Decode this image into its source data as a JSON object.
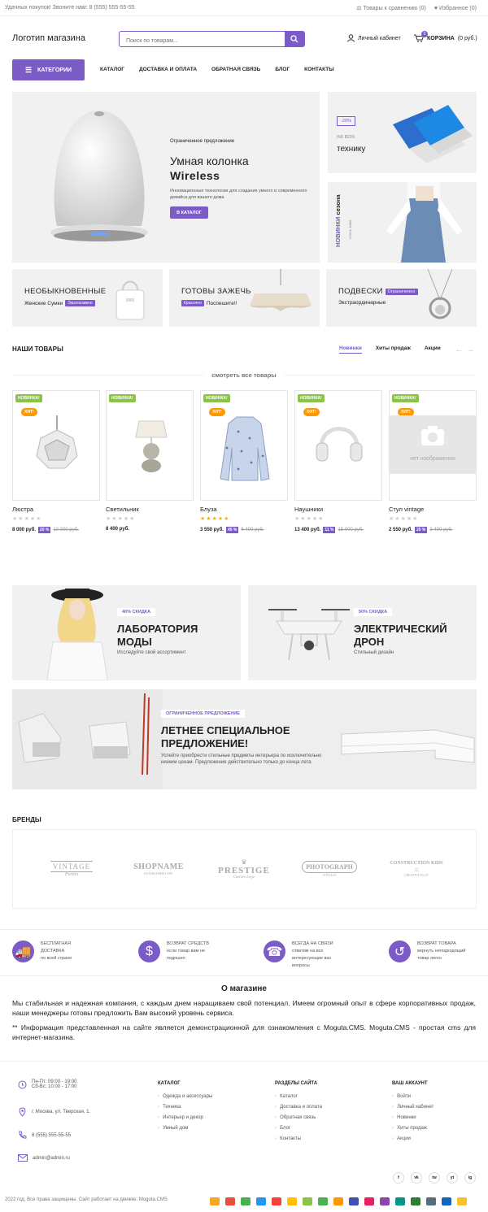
{
  "topbar": {
    "left_text": "Удачных покупок! Звоните нам: 8 (555) 555-55-55",
    "compare": "Товары к сравнению (0)",
    "favorites": "Избранное (0)"
  },
  "header": {
    "logo": "Логотип магазина",
    "search_placeholder": "Поиск по товарам...",
    "account": "Личный кабинет",
    "cart_label": "КОРЗИНА",
    "cart_total": "(0 руб.)",
    "cart_count": "0"
  },
  "nav": {
    "categories": "КАТЕГОРИИ",
    "links": [
      "КАТАЛОГ",
      "ДОСТАВКА И ОПЛАТА",
      "ОБРАТНАЯ СВЯЗЬ",
      "БЛОГ",
      "КОНТАКТЫ"
    ]
  },
  "hero": {
    "eyebrow": "Ограниченное предложение",
    "title_line1": "Умная колонка",
    "title_line2": "Wireless",
    "text": "Инновационные технологии для создания умного и современного девайса для вашего дома",
    "cta": "В КАТАЛОГ"
  },
  "side_banner1": {
    "badge": "-20%",
    "line1": "на всю",
    "line2": "технику"
  },
  "side_banner2": {
    "line1": "НОВИНКИ",
    "line2": "сезона",
    "line3": "осень зима"
  },
  "small_banners": [
    {
      "title": "НЕОБЫКНОВЕННЫЕ",
      "sub": "Женские Сумки",
      "tag": "Эксклюзивно"
    },
    {
      "title": "ГОТОВЫ ЗАЖЕЧЬ",
      "tag": "Красочно",
      "sub": "Поспешите!!"
    },
    {
      "title": "ПОДВЕСКИ",
      "tag": "Ограниченно",
      "sub": "Экстраординарные"
    }
  ],
  "products_section": {
    "title": "НАШИ ТОВАРЫ",
    "tabs": [
      "Новинки",
      "Хиты продаж",
      "Акции"
    ],
    "see_all": "смотреть все товары",
    "new_badge": "НОВИНКА!",
    "hit_badge": "ХИТ!",
    "no_image": "нет изображения"
  },
  "products": [
    {
      "name": "Люстра",
      "price": "8 000 руб.",
      "discount": "20 %",
      "old_price": "10 000 руб.",
      "rating": 0,
      "hit": true
    },
    {
      "name": "Светильник",
      "price": "8 400 руб.",
      "discount": "",
      "old_price": "",
      "rating": 0,
      "hit": false
    },
    {
      "name": "Блуза",
      "price": "3 550 руб.",
      "discount": "45 %",
      "old_price": "6 400 руб.",
      "rating": 5,
      "hit": true
    },
    {
      "name": "Наушники",
      "price": "13 400 руб.",
      "discount": "11 %",
      "old_price": "15 000 руб.",
      "rating": 0,
      "hit": true
    },
    {
      "name": "Стул vintage",
      "price": "2 550 руб.",
      "discount": "25 %",
      "old_price": "3 400 руб.",
      "rating": 0,
      "hit": true
    }
  ],
  "promo1": {
    "label": "40% СКИДКА",
    "line1": "ЛАБОРАТОРИЯ",
    "line2": "МОДЫ",
    "sub": "Исследуйте свой ассортимент"
  },
  "promo2": {
    "label": "50% СКИДКА",
    "line1": "ЭЛЕКТРИЧЕСКИЙ",
    "line2": "ДРОН",
    "sub": "Стильный дизайн"
  },
  "summer": {
    "label": "ОГРАНИЧЕННОЕ ПРЕДЛОЖЕНИЕ",
    "line1": "ЛЕТНЕЕ СПЕЦИАЛЬНОЕ",
    "line2": "ПРЕДЛОЖЕНИЕ!",
    "text": "Успейте приобрести стильные предметы интерьера по исключительно низким ценам. Предложение действительно только до конца лета"
  },
  "brands": {
    "title": "БРЕНДЫ",
    "items": [
      {
        "name": "VINTAGE",
        "sub": "Parkin"
      },
      {
        "name": "SHOPNAME",
        "sub": "ESTABLISHED 1987"
      },
      {
        "name": "PRESTIGE",
        "sub": "Custom Logo"
      },
      {
        "name": "PHOTOGRAPH",
        "sub": "VINTAGE"
      },
      {
        "name": "CONSTRUCTION KIDS",
        "sub": "CREATIVE PLAY"
      }
    ]
  },
  "features": [
    {
      "title": "БЕСПЛАТНАЯ ДОСТАВКА",
      "sub": "по всей стране"
    },
    {
      "title": "ВОЗВРАТ СРЕДСТВ",
      "sub": "если товар вам не подошел"
    },
    {
      "title": "ВСЕГДА НА СВЯЗИ",
      "sub": "ответим на все интересующие вас вопросы"
    },
    {
      "title": "ВОЗВРАТ ТОВАРА",
      "sub": "вернуть неподходящий товар легко"
    }
  ],
  "about": {
    "title": "О магазине",
    "p1": "Мы стабильная и надежная компания, с каждым днем наращиваем свой потенциал. Имеем огромный опыт в сфере корпоративных продаж, наши менеджеры готовы предложить Вам высокий уровень сервиса.",
    "p2": "** Информация представленная на сайте является демонстрационной для ознакомления с Moguta.CMS. Moguta.CMS - простая cms для интернет-магазина."
  },
  "footer": {
    "hours1": "Пн-Пт: 09:00 - 19:00",
    "hours2": "Сб-Вс: 10:00 - 17:00",
    "address": "г. Москва, ул. Тверская, 1.",
    "phone": "8 (555) 555-55-55",
    "email": "admin@admin.ru",
    "col_catalog": {
      "title": "КАТАЛОГ",
      "items": [
        "Одежда и аксессуары",
        "Техника",
        "Интерьер и декор",
        "Умный дом"
      ]
    },
    "col_sections": {
      "title": "РАЗДЕЛЫ САЙТА",
      "items": [
        "Каталог",
        "Доставка и оплата",
        "Обратная связь",
        "Блог",
        "Контакты"
      ]
    },
    "col_account": {
      "title": "ВАШ АККАУНТ",
      "items": [
        "Войти",
        "Личный кабинет",
        "Новинки",
        "Хиты продаж",
        "Акции"
      ]
    },
    "social": [
      "f",
      "vk",
      "tw",
      "yt",
      "ig"
    ],
    "copyright": "2022 год. Все права защищены. Сайт работает на движке: Moguta.CMS",
    "pay_colors": [
      "#f5a623",
      "#e94e3c",
      "#4caf50",
      "#2196f3",
      "#f44336",
      "#ffc107",
      "#8bc34a",
      "#4caf50",
      "#ff9800",
      "#3f51b5",
      "#e91e63",
      "#8e44ad",
      "#009688",
      "#2e7d32",
      "#546e7a",
      "#1565c0",
      "#fbc02d"
    ]
  }
}
